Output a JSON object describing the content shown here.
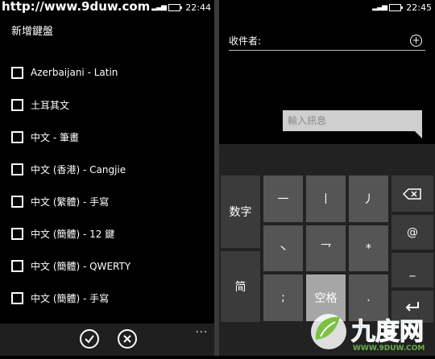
{
  "watermark": "http://www.9duw.com",
  "left": {
    "time": "22:44",
    "title": "新增鍵盤",
    "keyboards": [
      "Azerbaijani - Latin",
      "土耳其文",
      "中文 - 筆畫",
      "中文 (香港) - Cangjie",
      "中文 (繁體) - 手寫",
      "中文 (簡體) - 12 鍵",
      "中文 (簡體) - QWERTY",
      "中文 (簡體) - 手寫"
    ],
    "appbar_more": "..."
  },
  "right": {
    "time": "22:45",
    "to_label": "收件者:",
    "message_placeholder": "輸入訊息",
    "keys": {
      "numbers": "数字",
      "simplified": "简",
      "horizontal": "一",
      "vertical": "丨",
      "left_falling": "丿",
      "dot": "丶",
      "turning": "乛",
      "asterisk": "*",
      "semicolon": ";",
      "space": "空格",
      "period": ".",
      "at": "@",
      "dash": "_"
    }
  },
  "logo_text": "WWW.9DUW.COM"
}
